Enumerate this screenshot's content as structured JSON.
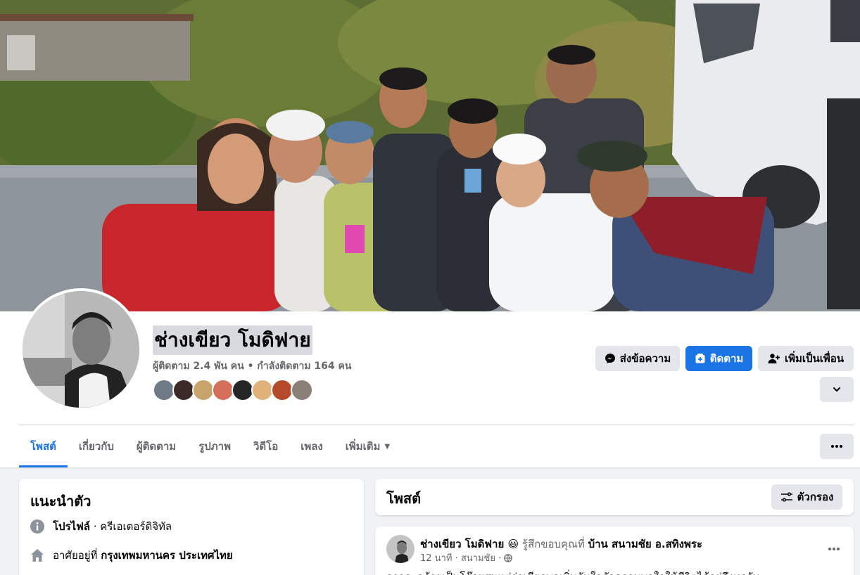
{
  "profile": {
    "name": "ช่างเขียว โมดิฟาย",
    "stats": "ผู้ติดตาม 2.4 พัน คน • กำลังติดตาม 164 คน"
  },
  "actions": {
    "message_label": "ส่งข้อความ",
    "follow_label": "ติดตาม",
    "add_friend_label": "เพิ่มเป็นเพื่อน"
  },
  "tabs": [
    {
      "label": "โพสต์",
      "active": true
    },
    {
      "label": "เกี่ยวกับ"
    },
    {
      "label": "ผู้ติดตาม"
    },
    {
      "label": "รูปภาพ"
    },
    {
      "label": "วิดีโอ"
    },
    {
      "label": "เพลง"
    },
    {
      "label": "เพิ่มเติม"
    }
  ],
  "intro": {
    "title": "แนะนำตัว",
    "profile_label": "โปรไฟล์",
    "profile_category": " · ครีเอเตอร์ดิจิทัล",
    "lives_prefix": "อาศัยอยู่ที่ ",
    "lives_place": "กรุงเทพมหานคร ประเทศไทย"
  },
  "posts_header": {
    "title": "โพสต์",
    "filter_label": "ตัวกรอง"
  },
  "post": {
    "author": "ช่างเขียว โมดิฟาย",
    "emoji": "😃",
    "feeling": " รู้สึกขอบคุณที่ ",
    "place": "บ้าน สนามชัย อ.สทิงพระ",
    "meta": "12 นาที · สนามชัย ·",
    "text_preview": "อาจจะคล้ายเป็นโจ๊กผสมแต่ว่าเขียวพอเพิ่มกันใจตัวความพอใจให้ชีวิตได้อยู่ถึงทุกวัน"
  },
  "colors": {
    "accent": "#1b74e4",
    "page_bg": "#f0f2f5",
    "button_gray": "#e4e6eb",
    "muted_text": "#65676b"
  },
  "icons": [
    "messenger-icon",
    "follow-icon",
    "add-friend-icon",
    "chevron-down-icon",
    "more-icon",
    "info-icon",
    "home-icon",
    "filter-icon",
    "globe-icon"
  ]
}
